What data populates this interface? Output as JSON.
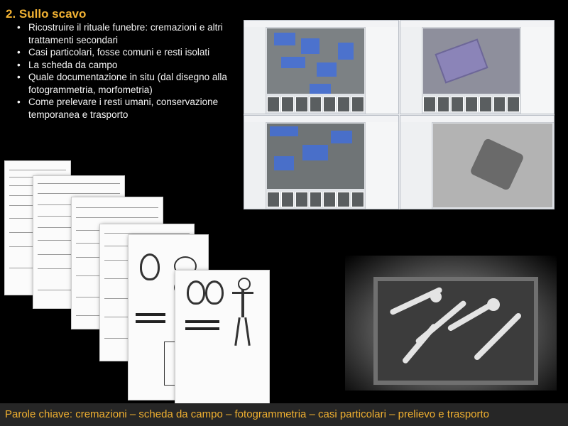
{
  "slide": {
    "title": "2. Sullo scavo",
    "bullets": [
      "Ricostruire il rituale funebre: cremazioni e altri trattamenti secondari",
      "Casi particolari, fosse comuni e resti isolati",
      "La scheda da campo",
      "Quale documentazione in situ (dal disegno alla fotogrammetria, morfometria)",
      "Come prelevare i resti umani, conservazione temporanea e trasporto"
    ],
    "footer": "Parole chiave: cremazioni – scheda da campo – fotogrammetria – casi particolari – prelievo e trasporto"
  },
  "colors": {
    "title": "#f2b233",
    "footer_text": "#f0b030",
    "background": "#000000",
    "mask": "#3c6ee6"
  }
}
